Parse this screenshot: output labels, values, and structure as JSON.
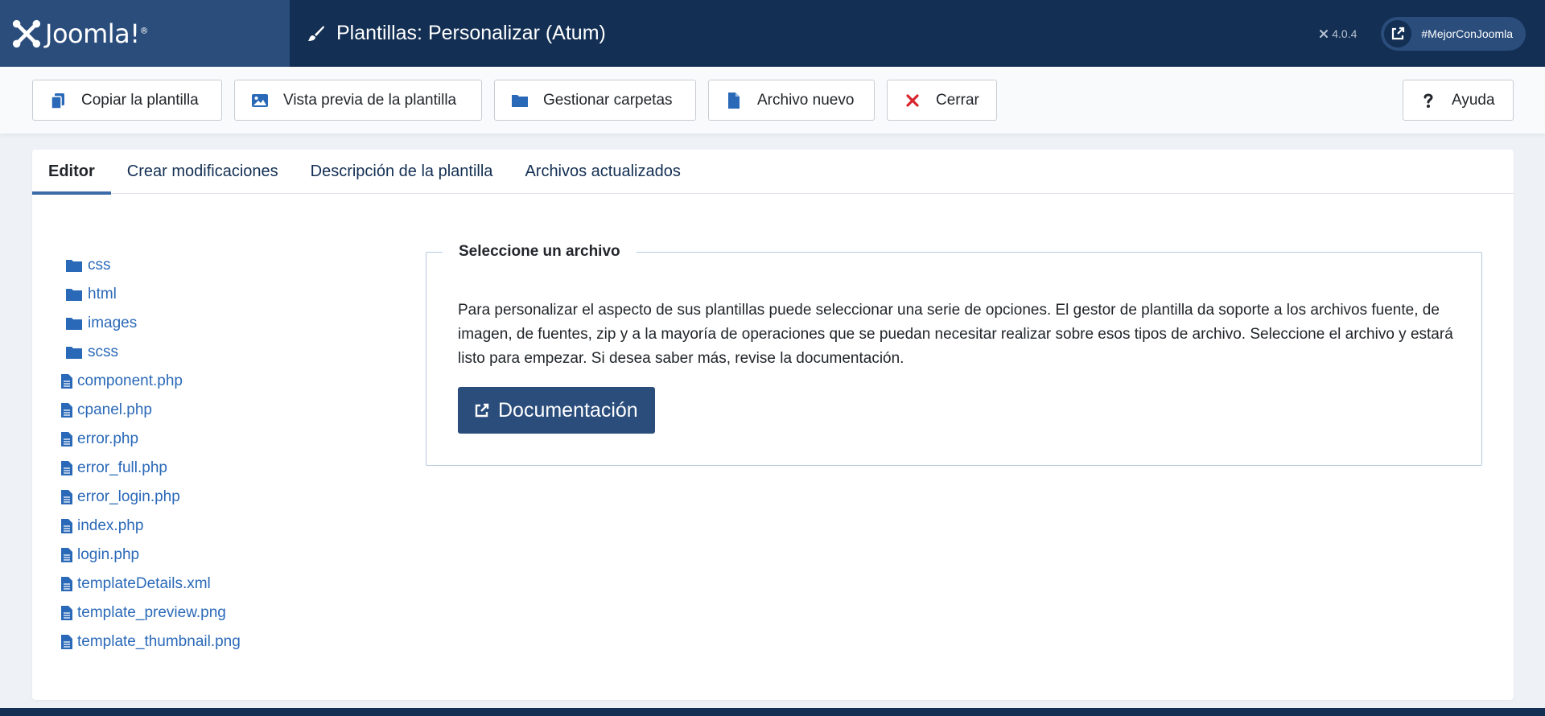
{
  "header": {
    "logo_text": "Joomla!",
    "logo_reg": "®",
    "title": "Plantillas: Personalizar (Atum)",
    "version": "4.0.4",
    "hashtag_link": "#MejorConJoomla"
  },
  "toolbar": {
    "copy_label": "Copiar la plantilla",
    "preview_label": "Vista previa de la plantilla",
    "folders_label": "Gestionar carpetas",
    "newfile_label": "Archivo nuevo",
    "close_label": "Cerrar",
    "help_label": "Ayuda"
  },
  "tabs": [
    {
      "label": "Editor",
      "active": true
    },
    {
      "label": "Crear modificaciones",
      "active": false
    },
    {
      "label": "Descripción de la plantilla",
      "active": false
    },
    {
      "label": "Archivos actualizados",
      "active": false
    }
  ],
  "tree": {
    "folders": [
      "css",
      "html",
      "images",
      "scss"
    ],
    "files": [
      "component.php",
      "cpanel.php",
      "error.php",
      "error_full.php",
      "error_login.php",
      "index.php",
      "login.php",
      "templateDetails.xml",
      "template_preview.png",
      "template_thumbnail.png"
    ]
  },
  "select_file": {
    "legend": "Seleccione un archivo",
    "description": "Para personalizar el aspecto de sus plantillas puede seleccionar una serie de opciones. El gestor de plantilla da soporte a los archivos fuente, de imagen, de fuentes, zip y a la mayoría de operaciones que se puedan necesitar realizar sobre esos tipos de archivo. Seleccione el archivo y estará listo para empezar. Si desea saber más, revise la documentación.",
    "doc_button": "Documentación"
  },
  "colors": {
    "header_bg": "#132f53",
    "logo_bg": "#2a4d7c",
    "link": "#2a69b8",
    "close_red": "#d6262e",
    "tab_indicator": "#3b6aa8"
  },
  "icons": {
    "copy": "copy-icon",
    "preview": "image-icon",
    "folders": "folder-icon",
    "newfile": "file-icon",
    "close": "close-icon",
    "help": "question-icon",
    "heading": "brush-icon",
    "external": "external-link-icon"
  }
}
